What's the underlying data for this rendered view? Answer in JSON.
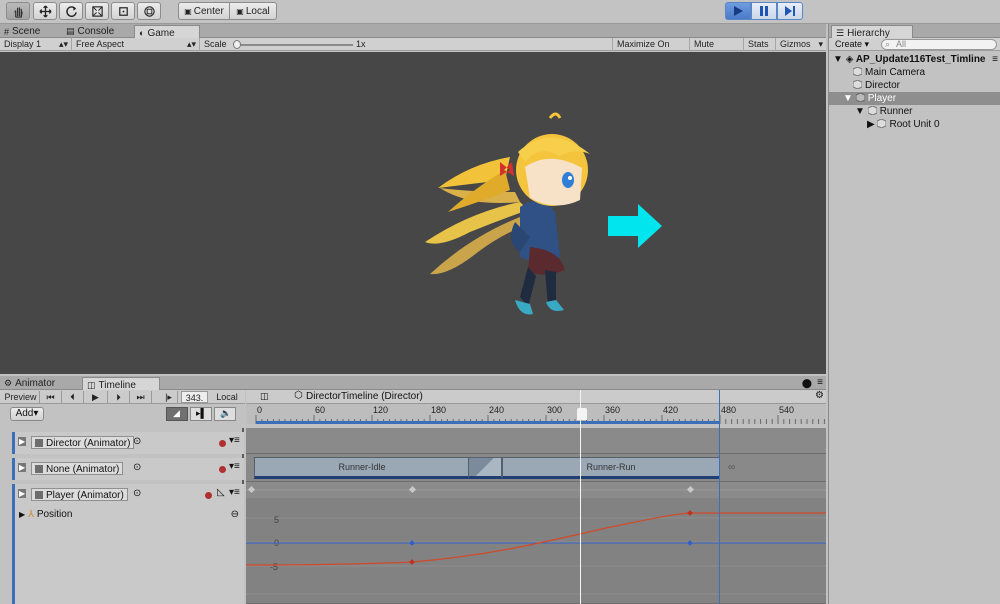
{
  "toolbar": {
    "pivot_center": "Center",
    "pivot_local": "Local"
  },
  "scene_tabs": {
    "scene": "Scene",
    "console": "Console",
    "game": "Game"
  },
  "game_toolbar": {
    "display": "Display 1",
    "aspect": "Free Aspect",
    "scale_label": "Scale",
    "scale_value": "1x",
    "maximize": "Maximize On Play",
    "mute": "Mute Audio",
    "stats": "Stats",
    "gizmos": "Gizmos"
  },
  "hierarchy": {
    "tab": "Hierarchy",
    "create": "Create",
    "search_placeholder": "All",
    "scene_name": "AP_Update116Test_Timline",
    "items": [
      {
        "label": "Main Camera"
      },
      {
        "label": "Director"
      },
      {
        "label": "Player"
      },
      {
        "label": "Runner"
      },
      {
        "label": "Root Unit 0"
      }
    ]
  },
  "timeline": {
    "animator_tab": "Animator",
    "timeline_tab": "Timeline",
    "preview": "Preview",
    "frame": "343.",
    "local": "Local",
    "add": "Add",
    "asset_name": "DirectorTimeline (Director)",
    "ruler_ticks": [
      "0",
      "60",
      "120",
      "180",
      "240",
      "300",
      "360",
      "420",
      "480",
      "540"
    ],
    "tracks": [
      {
        "name": "Director (Animator)"
      },
      {
        "name": "None (Animator)"
      },
      {
        "name": "Player (Animator)"
      }
    ],
    "property": "Position",
    "clips": [
      "Runner-Idle",
      "Runner-Run"
    ],
    "curve_labels": [
      "5",
      "0",
      "-5"
    ]
  },
  "colors": {
    "accent": "#3c6fb8",
    "record": "#b0302f",
    "arrow": "#00e5ee"
  }
}
